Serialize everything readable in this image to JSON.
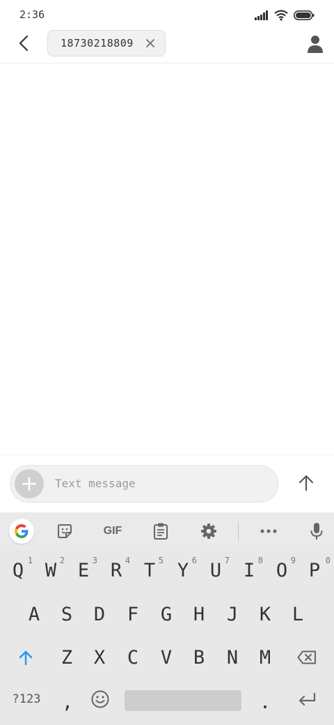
{
  "status_bar": {
    "time": "2:36"
  },
  "header": {
    "recipient": "18730218809"
  },
  "compose": {
    "placeholder": "Text message"
  },
  "keyboard": {
    "toolbar": {
      "gif_label": "GIF"
    },
    "row1": [
      {
        "letter": "Q",
        "hint": "1"
      },
      {
        "letter": "W",
        "hint": "2"
      },
      {
        "letter": "E",
        "hint": "3"
      },
      {
        "letter": "R",
        "hint": "4"
      },
      {
        "letter": "T",
        "hint": "5"
      },
      {
        "letter": "Y",
        "hint": "6"
      },
      {
        "letter": "U",
        "hint": "7"
      },
      {
        "letter": "I",
        "hint": "8"
      },
      {
        "letter": "O",
        "hint": "9"
      },
      {
        "letter": "P",
        "hint": "0"
      }
    ],
    "row2": [
      "A",
      "S",
      "D",
      "F",
      "G",
      "H",
      "J",
      "K",
      "L"
    ],
    "row3": [
      "Z",
      "X",
      "C",
      "V",
      "B",
      "N",
      "M"
    ],
    "symbols_label": "?123",
    "comma": ",",
    "period": "."
  },
  "colors": {
    "accent_blue": "#2196f3",
    "icon_gray": "#666666"
  }
}
